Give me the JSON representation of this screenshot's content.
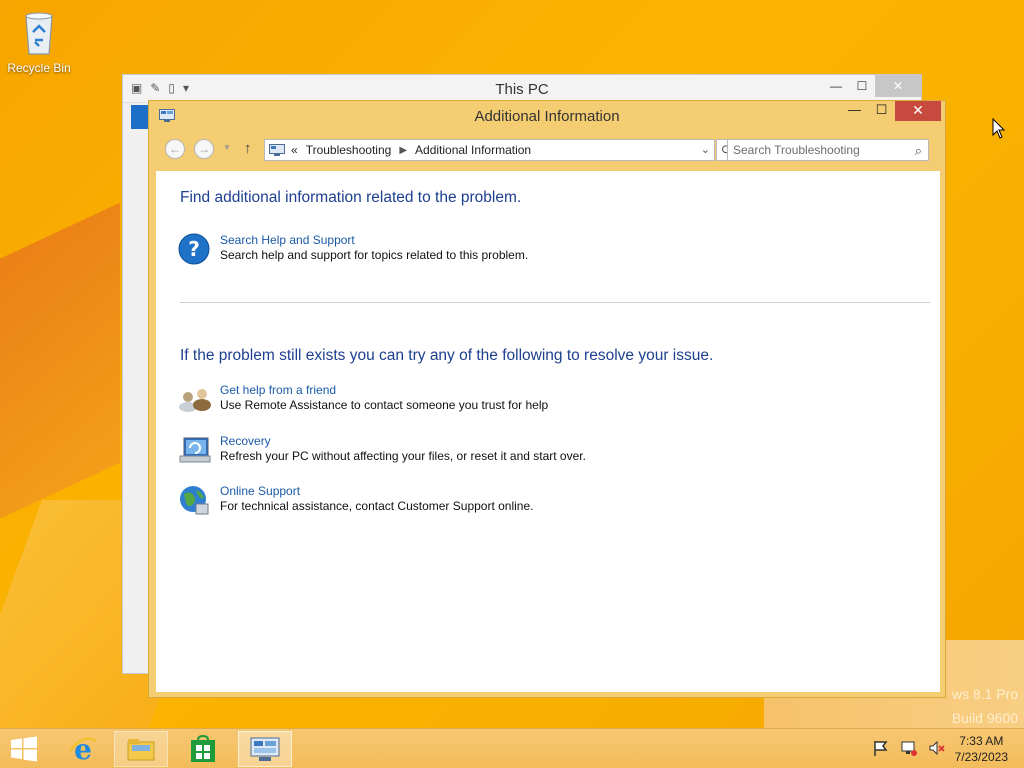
{
  "desktop": {
    "recycle_bin_label": "Recycle Bin",
    "watermark_line1": "ws 8.1 Pro",
    "watermark_line2": "Build 9600"
  },
  "back_window": {
    "title": "This PC"
  },
  "window": {
    "title": "Additional Information",
    "controls": {
      "minimize": "—",
      "maximize": "☐",
      "close": "✕"
    }
  },
  "navbar": {
    "breadcrumb_prefix": "«",
    "breadcrumb": [
      "Troubleshooting",
      "Additional Information"
    ],
    "search_placeholder": "Search Troubleshooting"
  },
  "content": {
    "heading1": "Find additional information related to the problem.",
    "heading2": "If the problem still exists you can try any of the following to resolve your issue.",
    "tasks": [
      {
        "title": "Search Help and Support",
        "desc": "Search help and support for topics related to this problem.",
        "icon": "help-icon"
      },
      {
        "title": "Get help from a friend",
        "desc": "Use Remote Assistance to contact someone you trust for help",
        "icon": "remote-assistance-icon"
      },
      {
        "title": "Recovery",
        "desc": "Refresh your PC without affecting your files, or reset it and start over.",
        "icon": "recovery-icon"
      },
      {
        "title": "Online Support",
        "desc": "For technical assistance, contact Customer Support online.",
        "icon": "globe-icon"
      }
    ]
  },
  "taskbar": {
    "clock_time": "7:33 AM",
    "clock_date": "7/23/2023"
  },
  "colors": {
    "accent_heading": "#1e3f8f",
    "link": "#1a5aa8",
    "window_frame": "#f4cd72",
    "close_button": "#c74a3e"
  }
}
